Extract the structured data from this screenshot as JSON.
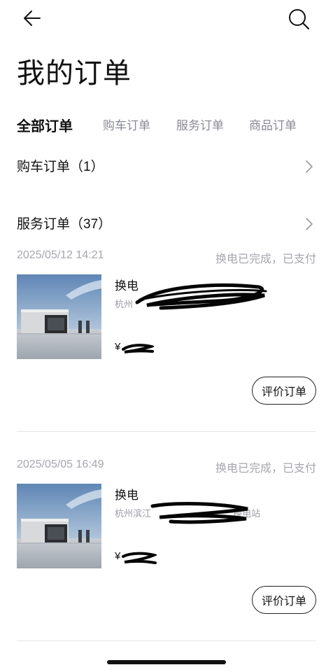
{
  "header": {
    "back_icon": "arrow-left-icon",
    "search_icon": "search-icon",
    "title": "我的订单"
  },
  "tabs": [
    {
      "label": "全部订单",
      "active": true
    },
    {
      "label": "购车订单",
      "active": false
    },
    {
      "label": "服务订单",
      "active": false
    },
    {
      "label": "商品订单",
      "active": false
    }
  ],
  "sections": {
    "car_orders": {
      "label": "购车订单（1）"
    },
    "service_orders": {
      "label": "服务订单（37）"
    }
  },
  "orders": [
    {
      "date": "2025/05/12 14:21",
      "status": "换电已完成，已支付",
      "type": "换电",
      "location": "杭州",
      "price": "¥",
      "action": "评价订单"
    },
    {
      "date": "2025/05/05 16:49",
      "status": "换电已完成，已支付",
      "type": "换电",
      "location": "杭州滨江",
      "location_suffix": "换电站",
      "price": "¥",
      "action": "评价订单"
    }
  ],
  "colors": {
    "text_primary": "#111111",
    "text_secondary": "#a6a6ae",
    "tab_inactive": "#8a8a96",
    "divider": "#e6e6ea"
  }
}
